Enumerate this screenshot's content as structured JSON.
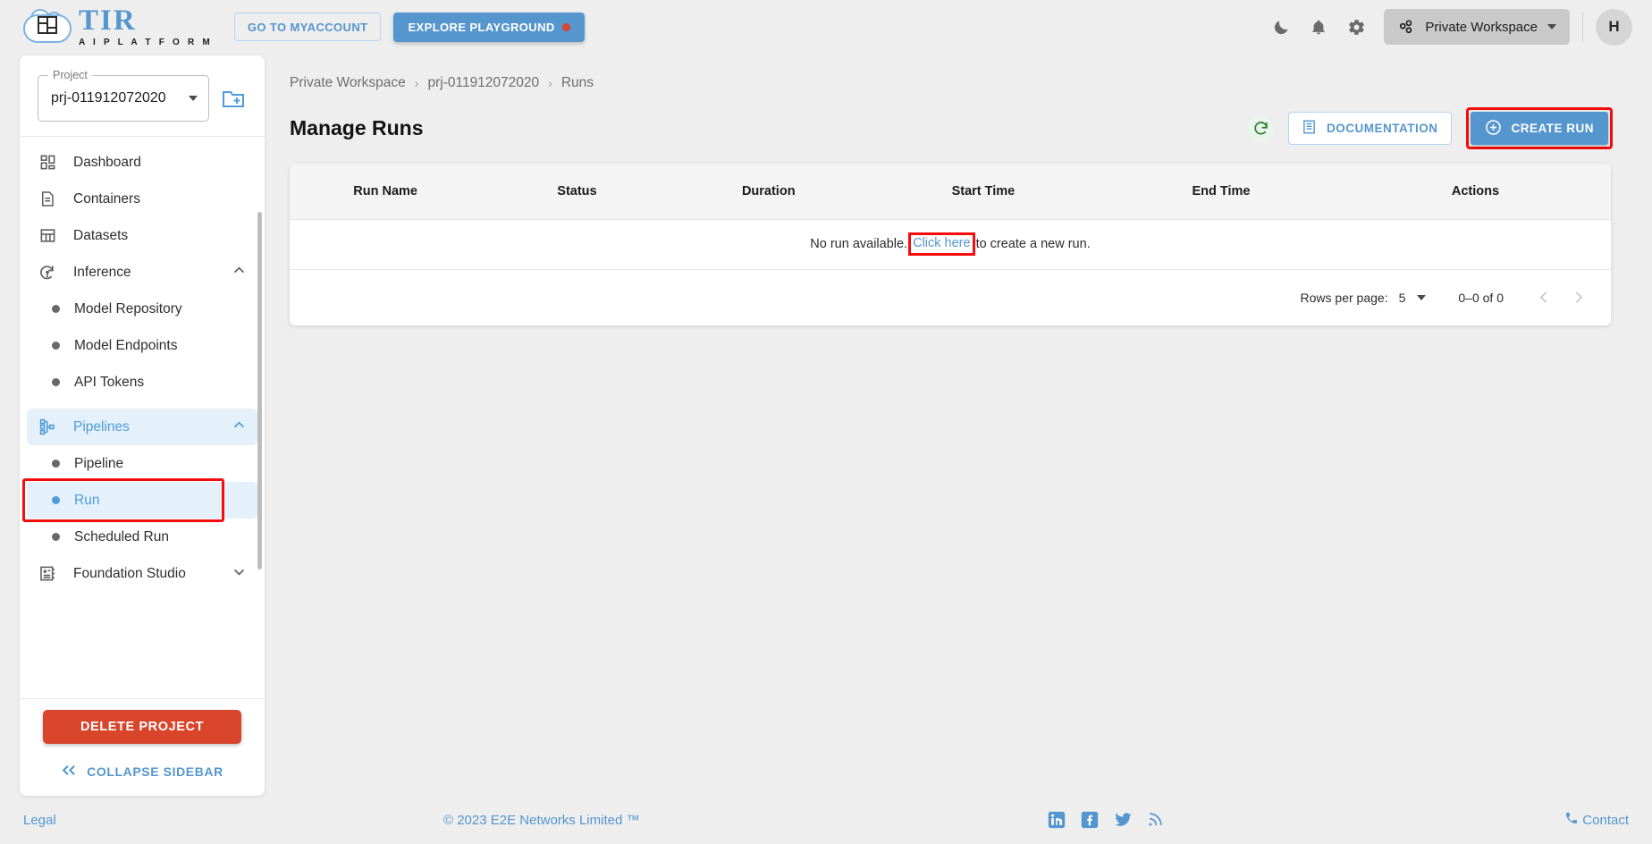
{
  "topbar": {
    "logo": {
      "title": "TIR",
      "subtitle": "A I   P L A T F O R M",
      "icon": "tir-cloud-logo"
    },
    "myaccount_label": "GO TO MYACCOUNT",
    "playground_label": "EXPLORE PLAYGROUND",
    "icons": [
      "moon-icon",
      "bell-icon",
      "gear-icon"
    ],
    "workspace_label": "Private Workspace",
    "avatar_initial": "H"
  },
  "sidebar": {
    "project": {
      "legend": "Project",
      "value": "prj-011912072020"
    },
    "new_project_icon": "folder-add-icon",
    "items": [
      {
        "label": "Dashboard",
        "icon": "dashboard-icon",
        "type": "item"
      },
      {
        "label": "Containers",
        "icon": "document-icon",
        "type": "item"
      },
      {
        "label": "Datasets",
        "icon": "grid-icon",
        "type": "item"
      },
      {
        "label": "Inference",
        "icon": "inference-icon",
        "type": "group",
        "expanded": true
      },
      {
        "label": "Model Repository",
        "type": "sub"
      },
      {
        "label": "Model Endpoints",
        "type": "sub"
      },
      {
        "label": "API Tokens",
        "type": "sub"
      },
      {
        "label": "Pipelines",
        "icon": "pipeline-icon",
        "type": "group",
        "expanded": true,
        "active": true
      },
      {
        "label": "Pipeline",
        "type": "sub"
      },
      {
        "label": "Run",
        "type": "sub",
        "selected": true,
        "highlighted": true
      },
      {
        "label": "Scheduled Run",
        "type": "sub"
      },
      {
        "label": "Foundation Studio",
        "icon": "studio-icon",
        "type": "group",
        "expanded": false
      }
    ],
    "delete_label": "DELETE PROJECT",
    "collapse_label": "COLLAPSE SIDEBAR"
  },
  "main": {
    "breadcrumb": [
      "Private Workspace",
      "prj-011912072020",
      "Runs"
    ],
    "breadcrumb_separator": "›",
    "page_title": "Manage Runs",
    "refresh_icon": "refresh-icon",
    "documentation_label": "DOCUMENTATION",
    "create_run_label": "CREATE RUN",
    "table": {
      "columns": [
        "Run Name",
        "Status",
        "Duration",
        "Start Time",
        "End Time",
        "Actions"
      ],
      "rows": [],
      "empty_prefix": "No run available.",
      "empty_link": "Click here",
      "empty_suffix": "to create a new run."
    },
    "pagination": {
      "rows_per_page_label": "Rows per page:",
      "rows_per_page_value": "5",
      "range_label": "0–0 of 0",
      "prev_icon": "chevron-left-icon",
      "next_icon": "chevron-right-icon"
    }
  },
  "footer": {
    "legal": "Legal",
    "copyright": "© 2023 E2E Networks Limited ™",
    "social": [
      "linkedin-icon",
      "facebook-icon",
      "twitter-icon",
      "rss-icon"
    ],
    "contact": "Contact"
  },
  "colors": {
    "accent": "#5596cf",
    "danger": "#d9452b",
    "highlight": "#f50c0c",
    "sidebar_active_bg": "#e4f1fb"
  }
}
